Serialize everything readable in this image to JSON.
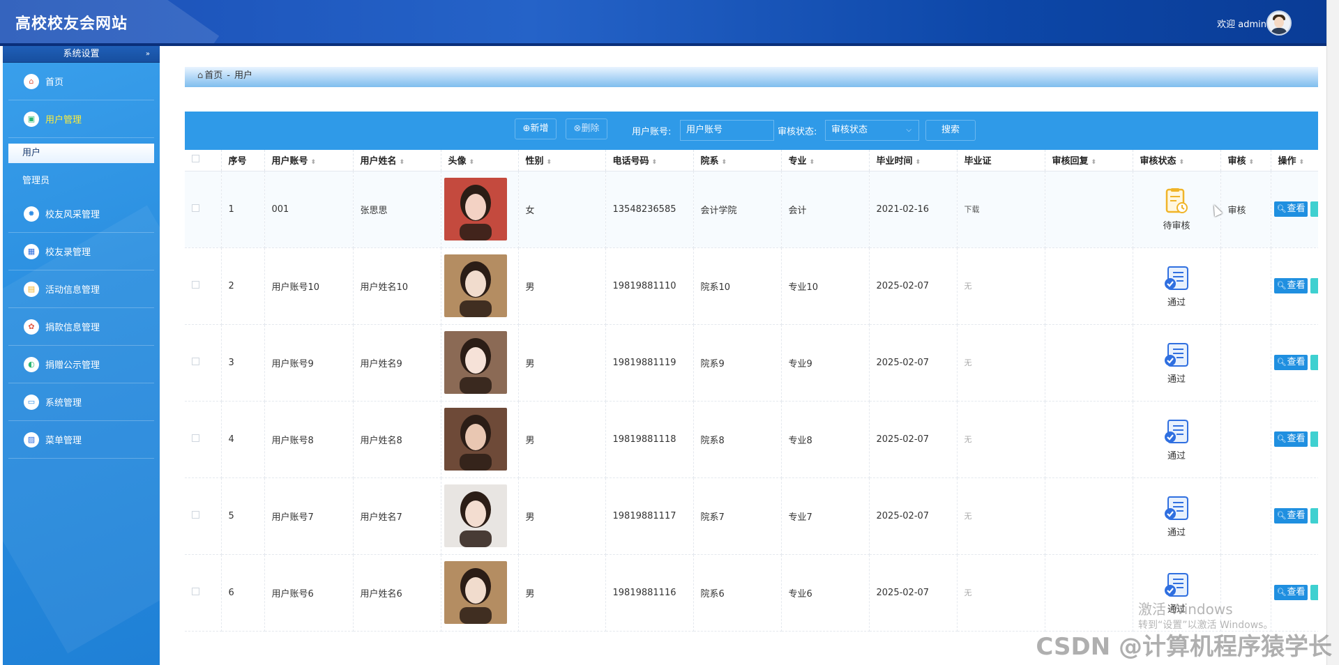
{
  "header": {
    "site_title": "高校校友会网站",
    "welcome": "欢迎 admin"
  },
  "sidebar": {
    "section_title": "系统设置",
    "items": [
      {
        "label": "首页",
        "icon": "home-icon",
        "color": "#e25b45"
      },
      {
        "label": "用户管理",
        "icon": "user-manage-icon",
        "color": "#2bb673",
        "active": true
      },
      {
        "label": "校友风采管理",
        "icon": "gear-icon",
        "color": "#2f8de4"
      },
      {
        "label": "校友录管理",
        "icon": "grid-icon",
        "color": "#2f6fe0"
      },
      {
        "label": "活动信息管理",
        "icon": "tiles-icon",
        "color": "#f0b428"
      },
      {
        "label": "捐款信息管理",
        "icon": "flower-icon",
        "color": "#e25b45"
      },
      {
        "label": "捐赠公示管理",
        "icon": "toggle-icon",
        "color": "#2bb673"
      },
      {
        "label": "系统管理",
        "icon": "window-icon",
        "color": "#2f8de4"
      },
      {
        "label": "菜单管理",
        "icon": "crop-icon",
        "color": "#2f6fe0"
      }
    ],
    "sub_items": [
      {
        "label": "用户",
        "selected": true
      },
      {
        "label": "管理员"
      }
    ]
  },
  "breadcrumb": {
    "home": "首页",
    "separator": "-",
    "current": "用户"
  },
  "toolbar": {
    "add_label": "新增",
    "delete_label": "删除",
    "account_label": "用户账号:",
    "account_placeholder": "用户账号",
    "status_label": "审核状态:",
    "status_placeholder": "审核状态",
    "search_label": "搜索"
  },
  "table": {
    "columns": [
      "序号",
      "用户账号",
      "用户姓名",
      "头像",
      "性别",
      "电话号码",
      "院系",
      "专业",
      "毕业时间",
      "毕业证",
      "审核回复",
      "审核状态",
      "审核",
      "操作"
    ],
    "rows": [
      {
        "no": "1",
        "account": "001",
        "name": "张思思",
        "gender": "女",
        "phone": "13548236585",
        "dept": "会计学院",
        "major": "会计",
        "grad": "2021-02-16",
        "cert": "下载",
        "reply": "",
        "status": "待审核",
        "audit": "审核",
        "action": "查看",
        "avatar_bg": "#c44a3e",
        "avatar_face": "#f3d2c4"
      },
      {
        "no": "2",
        "account": "用户账号10",
        "name": "用户姓名10",
        "gender": "男",
        "phone": "19819881110",
        "dept": "院系10",
        "major": "专业10",
        "grad": "2025-02-07",
        "cert": "无",
        "reply": "",
        "status": "通过",
        "audit": "",
        "action": "查看",
        "avatar_bg": "#b48d62",
        "avatar_face": "#f1dccd"
      },
      {
        "no": "3",
        "account": "用户账号9",
        "name": "用户姓名9",
        "gender": "男",
        "phone": "19819881119",
        "dept": "院系9",
        "major": "专业9",
        "grad": "2025-02-07",
        "cert": "无",
        "reply": "",
        "status": "通过",
        "audit": "",
        "action": "查看",
        "avatar_bg": "#8b6a55",
        "avatar_face": "#f6e2d8"
      },
      {
        "no": "4",
        "account": "用户账号8",
        "name": "用户姓名8",
        "gender": "男",
        "phone": "19819881118",
        "dept": "院系8",
        "major": "专业8",
        "grad": "2025-02-07",
        "cert": "无",
        "reply": "",
        "status": "通过",
        "audit": "",
        "action": "查看",
        "avatar_bg": "#6e4a38",
        "avatar_face": "#e9c7b2"
      },
      {
        "no": "5",
        "account": "用户账号7",
        "name": "用户姓名7",
        "gender": "男",
        "phone": "19819881117",
        "dept": "院系7",
        "major": "专业7",
        "grad": "2025-02-07",
        "cert": "无",
        "reply": "",
        "status": "通过",
        "audit": "",
        "action": "查看",
        "avatar_bg": "#e8e5e2",
        "avatar_face": "#f3ddd0"
      },
      {
        "no": "6",
        "account": "用户账号6",
        "name": "用户姓名6",
        "gender": "男",
        "phone": "19819881116",
        "dept": "院系6",
        "major": "专业6",
        "grad": "2025-02-07",
        "cert": "无",
        "reply": "",
        "status": "通过",
        "audit": "",
        "action": "查看",
        "avatar_bg": "#b48d62",
        "avatar_face": "#f1dccd"
      }
    ]
  },
  "overlays": {
    "win_activate": "激活 Windows",
    "win_hint": "转到“设置”以激活 Windows。",
    "csdn": "CSDN @计算机程序猿学长"
  }
}
